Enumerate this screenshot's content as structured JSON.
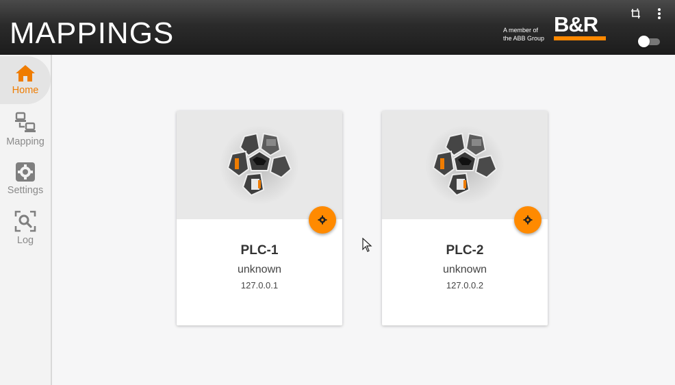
{
  "header": {
    "title": "MAPPINGS",
    "brand_member_line1": "A member of",
    "brand_member_line2": "the ABB Group",
    "brand_name": "B&R",
    "accent_color": "#ff8800"
  },
  "sidebar": {
    "items": [
      {
        "label": "Home",
        "icon": "home-icon",
        "active": true
      },
      {
        "label": "Mapping",
        "icon": "network-icon",
        "active": false
      },
      {
        "label": "Settings",
        "icon": "gear-icon",
        "active": false
      },
      {
        "label": "Log",
        "icon": "search-icon",
        "active": false
      }
    ]
  },
  "cards": [
    {
      "name": "PLC-1",
      "status": "unknown",
      "ip": "127.0.0.1"
    },
    {
      "name": "PLC-2",
      "status": "unknown",
      "ip": "127.0.0.2"
    }
  ],
  "colors": {
    "active_nav": "#ef7c00",
    "fab": "#ff8a00"
  }
}
